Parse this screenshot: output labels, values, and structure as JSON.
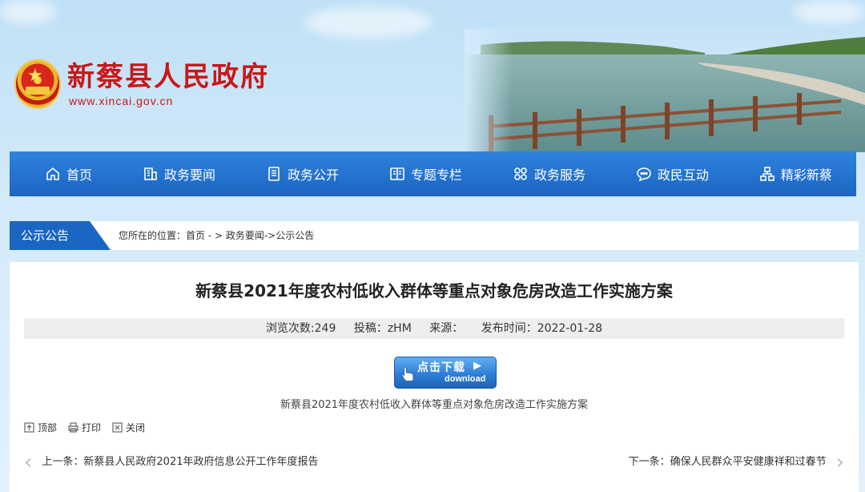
{
  "site": {
    "title": "新蔡县人民政府",
    "url": "www.xincai.gov.cn"
  },
  "nav": [
    {
      "label": "首页",
      "icon": "home-icon"
    },
    {
      "label": "政务要闻",
      "icon": "building-icon"
    },
    {
      "label": "政务公开",
      "icon": "document-icon"
    },
    {
      "label": "专题专栏",
      "icon": "book-icon"
    },
    {
      "label": "政务服务",
      "icon": "grid-icon"
    },
    {
      "label": "政民互动",
      "icon": "chat-icon"
    },
    {
      "label": "精彩新蔡",
      "icon": "network-icon"
    }
  ],
  "breadcrumb": {
    "section": "公示公告",
    "path": "您所在的位置：首页 - >  政务要闻->公示公告"
  },
  "article": {
    "title": "新蔡县2021年度农村低收入群体等重点对象危房改造工作实施方案",
    "meta": {
      "views": "浏览次数:249",
      "author": "投稿：zHM",
      "source": "来源：",
      "date": "发布时间：2022-01-28"
    },
    "download": {
      "label_cn": "点击下载",
      "label_en": "download"
    },
    "attachment": "新蔡县2021年度农村低收入群体等重点对象危房改造工作实施方案",
    "tools": {
      "top": "顶部",
      "print": "打印",
      "close": "关闭"
    },
    "prev": "上一条：新蔡县人民政府2021年政府信息公开工作年度报告",
    "next": "下一条：确保人民群众平安健康祥和过春节"
  },
  "colors": {
    "nav_blue": "#1b66c2",
    "title_red": "#c81818"
  }
}
